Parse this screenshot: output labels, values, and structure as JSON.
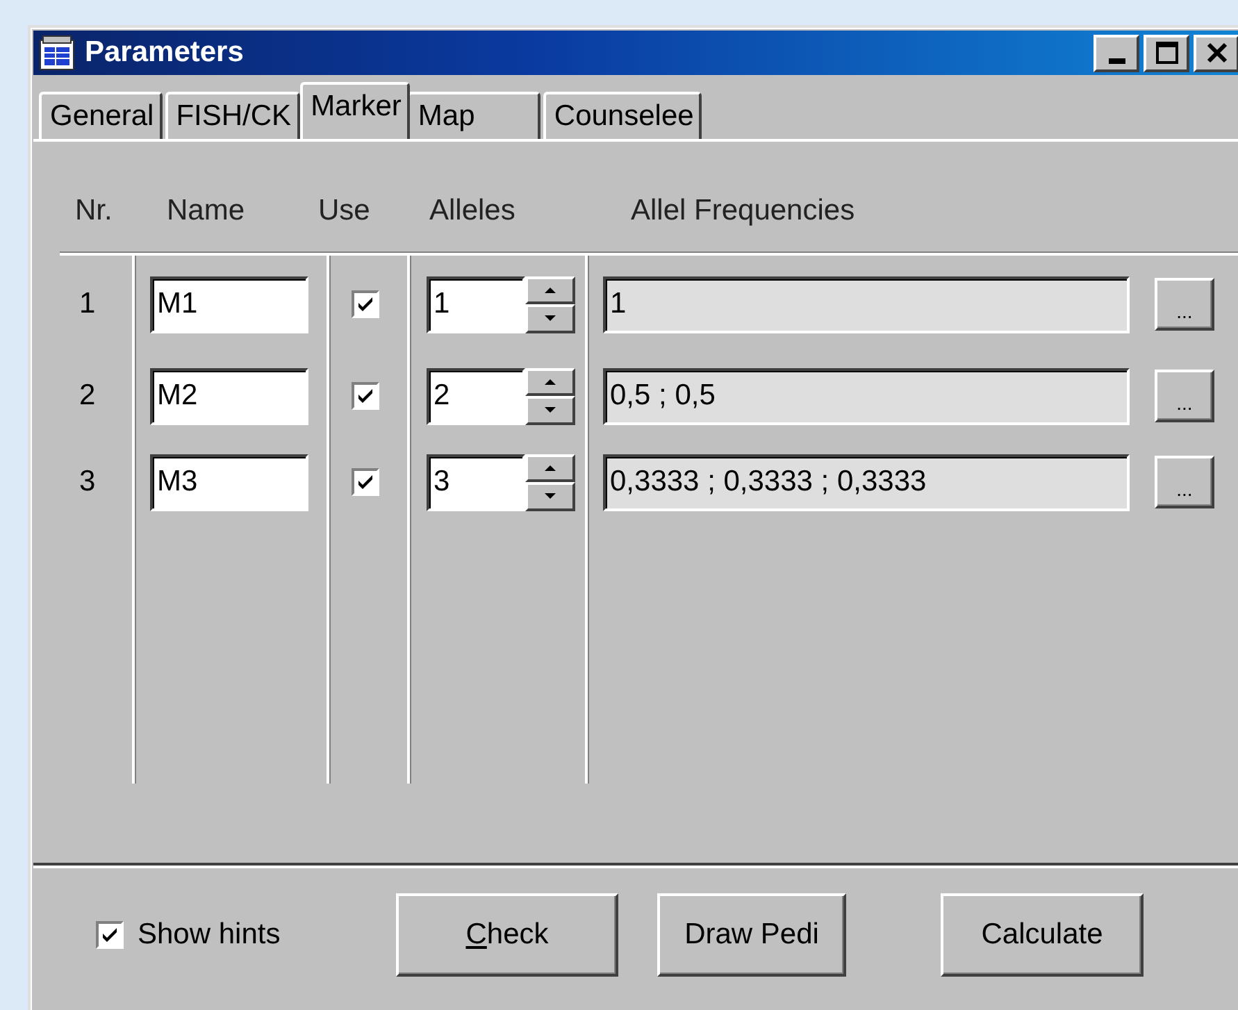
{
  "window": {
    "title": "Parameters"
  },
  "tabs": [
    {
      "label": "General",
      "selected": false
    },
    {
      "label": "FISH/CK",
      "selected": false
    },
    {
      "label": "Marker",
      "selected": true
    },
    {
      "label": "Map",
      "selected": false
    },
    {
      "label": "Counselee",
      "selected": false
    }
  ],
  "table": {
    "columns": [
      "Nr.",
      "Name",
      "Use",
      "Alleles",
      "Allel Frequencies"
    ],
    "rows": [
      {
        "nr": "1",
        "name": "M1",
        "use": true,
        "alleles": "1",
        "frequencies": "1",
        "button": "..."
      },
      {
        "nr": "2",
        "name": "M2",
        "use": true,
        "alleles": "2",
        "frequencies": "0,5 ; 0,5",
        "button": "..."
      },
      {
        "nr": "3",
        "name": "M3",
        "use": true,
        "alleles": "3",
        "frequencies": "0,3333 ; 0,3333 ; 0,3333",
        "button": "..."
      }
    ]
  },
  "show_hints": {
    "label": "Show hints",
    "checked": true
  },
  "buttons": [
    {
      "label": "Check",
      "underline_first": true
    },
    {
      "label": "Draw Pedi",
      "underline_first": false
    },
    {
      "label": "Calculate",
      "underline_first": false
    }
  ]
}
